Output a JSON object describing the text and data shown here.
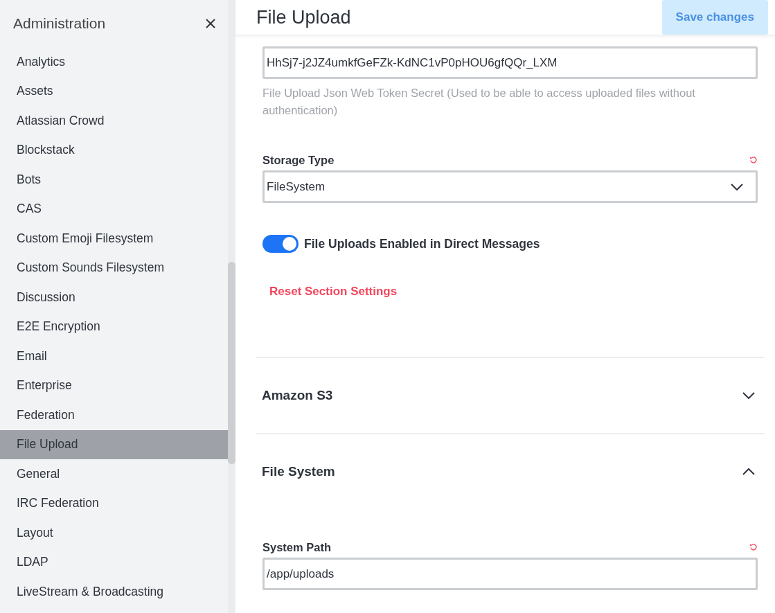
{
  "sidebar": {
    "title": "Administration",
    "items": [
      {
        "label": "Analytics",
        "selected": false
      },
      {
        "label": "Assets",
        "selected": false
      },
      {
        "label": "Atlassian Crowd",
        "selected": false
      },
      {
        "label": "Blockstack",
        "selected": false
      },
      {
        "label": "Bots",
        "selected": false
      },
      {
        "label": "CAS",
        "selected": false
      },
      {
        "label": "Custom Emoji Filesystem",
        "selected": false
      },
      {
        "label": "Custom Sounds Filesystem",
        "selected": false
      },
      {
        "label": "Discussion",
        "selected": false
      },
      {
        "label": "E2E Encryption",
        "selected": false
      },
      {
        "label": "Email",
        "selected": false
      },
      {
        "label": "Enterprise",
        "selected": false
      },
      {
        "label": "Federation",
        "selected": false
      },
      {
        "label": "File Upload",
        "selected": true
      },
      {
        "label": "General",
        "selected": false
      },
      {
        "label": "IRC Federation",
        "selected": false
      },
      {
        "label": "Layout",
        "selected": false
      },
      {
        "label": "LDAP",
        "selected": false
      },
      {
        "label": "LiveStream & Broadcasting",
        "selected": false
      }
    ]
  },
  "header": {
    "title": "File Upload",
    "save_button": {
      "label": "Save changes",
      "disabled": true
    }
  },
  "settings": [
    {
      "kind": "text",
      "value": "HhSj7-j2JZ4umkfGeFZk-KdNC1vP0pHOU6gfQQr_LXM",
      "hint": "File Upload Json Web Token Secret (Used to be able to access uploaded files without authentication)"
    },
    {
      "kind": "select",
      "label": "Storage Type",
      "value": "FileSystem",
      "resettable": true
    },
    {
      "kind": "toggle",
      "label": "File Uploads Enabled in Direct Messages",
      "on": true
    },
    {
      "kind": "reset",
      "label": "Reset Section Settings"
    }
  ],
  "sections": [
    {
      "title": "Amazon S3",
      "expanded": false
    },
    {
      "title": "File System",
      "expanded": true,
      "settings": [
        {
          "kind": "text",
          "label": "System Path",
          "value": "/app/uploads",
          "resettable": true
        }
      ]
    }
  ]
}
